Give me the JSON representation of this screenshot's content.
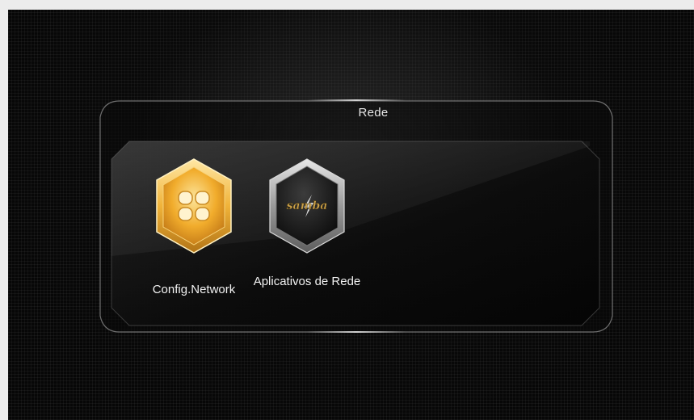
{
  "menu": {
    "title": "Rede",
    "items": [
      {
        "label": "Config.Network",
        "icon": "network-config-icon",
        "selected": true
      },
      {
        "label": "Aplicativos de Rede",
        "icon_text": "samba",
        "icon": "samba-icon",
        "selected": false
      }
    ]
  },
  "colors": {
    "background": "#070707",
    "selected_accent": "#f0b33a",
    "text": "#f2f2f2"
  }
}
